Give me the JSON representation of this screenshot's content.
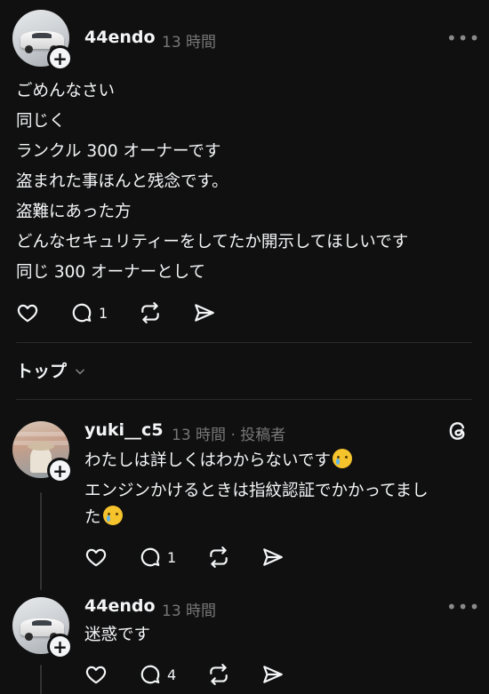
{
  "post": {
    "username": "44endo",
    "time": "13 時間",
    "more": "•••",
    "lines": [
      "ごめんなさい",
      "同じく",
      "ランクル 300 オーナーです",
      "盗まれた事ほんと残念です。",
      "盗難にあった方",
      "どんなセキュリティーをしてたか開示してほしいです",
      "同じ 300 オーナーとして"
    ],
    "reply_count": "1"
  },
  "sort": {
    "label": "トップ",
    "icon": "chevron-down-icon"
  },
  "reply1": {
    "username": "yuki__c5",
    "meta": "13 時間 · 投稿者",
    "line1": "わたしは詳しくはわからないです",
    "line2": "エンジンかけるときは指紋認証でかかってまし",
    "line3": "た",
    "reply_count": "1",
    "badge_icon": "threads-logo-icon"
  },
  "reply2": {
    "username": "44endo",
    "time": "13 時間",
    "more": "•••",
    "text": "迷惑です",
    "reply_count": "4"
  },
  "colors": {
    "background": "#101010",
    "text": "#f3f5f7",
    "muted": "#777777",
    "divider": "#2a2a2a"
  }
}
